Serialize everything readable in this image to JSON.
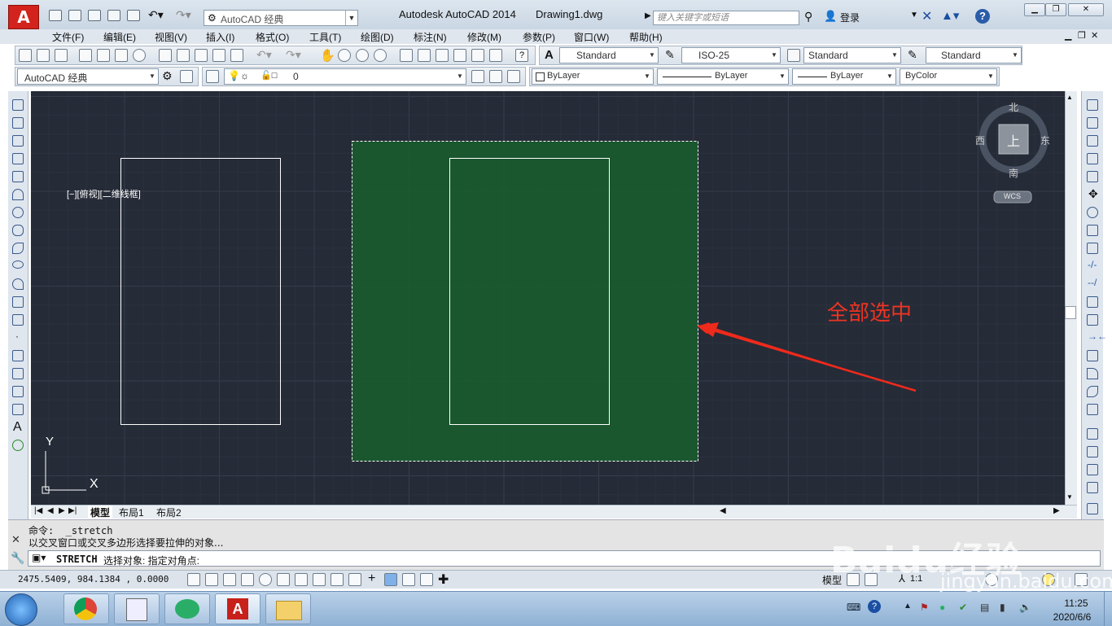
{
  "titlebar": {
    "workspace": "AutoCAD 经典",
    "app_title": "Autodesk AutoCAD 2014",
    "file_title": "Drawing1.dwg",
    "search_placeholder": "键入关键字或短语",
    "login": "登录",
    "help": "?"
  },
  "menu": [
    "文件(F)",
    "编辑(E)",
    "视图(V)",
    "插入(I)",
    "格式(O)",
    "工具(T)",
    "绘图(D)",
    "标注(N)",
    "修改(M)",
    "参数(P)",
    "窗口(W)",
    "帮助(H)"
  ],
  "styles_toolbar": {
    "text_style": "Standard",
    "dim_style": "ISO-25",
    "table_style": "Standard",
    "multileader_style": "Standard"
  },
  "layers_toolbar": {
    "workspace": "AutoCAD 经典",
    "layer": "0",
    "color": "ByLayer",
    "linetype": "ByLayer",
    "lineweight": "ByLayer",
    "plot_style": "ByColor"
  },
  "viewport": {
    "label": "[−][俯视][二维线框]",
    "compass": {
      "north": "北",
      "south": "南",
      "east": "东",
      "west": "西",
      "top": "上"
    },
    "wcs": "WCS",
    "ucs_x": "X",
    "ucs_y": "Y"
  },
  "annotation": "全部选中",
  "layout_tabs": [
    "模型",
    "布局1",
    "布局2"
  ],
  "command": {
    "history_1": "命令:  _stretch",
    "history_2": "以交叉窗口或交叉多边形选择要拉伸的对象...",
    "prompt_cmd": "STRETCH",
    "prompt_text": "选择对象: 指定对角点:"
  },
  "status": {
    "coords": "2475.5409, 984.1384 , 0.0000",
    "model": "模型",
    "scale": "1:1"
  },
  "taskbar": {
    "time": "11:25",
    "date": "2020/6/6"
  },
  "watermark": {
    "brand": "Baidu经验",
    "url": "jingyan.baidu.com"
  },
  "colors": {
    "canvas": "#252b37",
    "selection_fill": "#1a5c2e",
    "annotation": "#ee3322"
  }
}
